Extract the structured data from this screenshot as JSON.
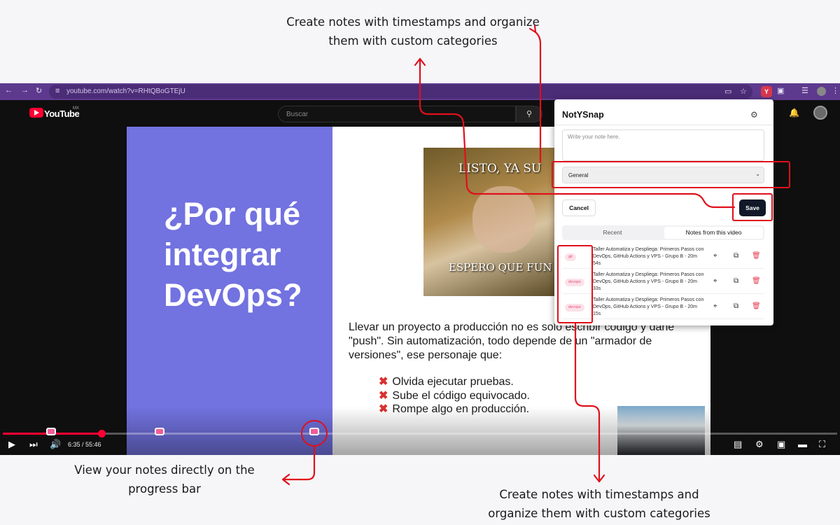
{
  "captions": {
    "top": "Create notes with timestamps and organize them with custom categories",
    "left": "View your notes directly on the progress bar",
    "bottom": "Create notes with timestamps and organize them with custom categories"
  },
  "browser": {
    "url": "youtube.com/watch?v=RHtQBoGTEjU",
    "extension_badge": "Y",
    "icons": [
      "back-icon",
      "forward-icon",
      "reload-icon",
      "site-info-icon",
      "cast-icon",
      "star-icon",
      "extensions-icon",
      "menu-icon"
    ]
  },
  "youtube": {
    "brand": "YouTube",
    "region": "MX",
    "search_placeholder": "Buscar"
  },
  "slide": {
    "title": "¿Por qué integrar DevOps?",
    "meme_top": "LISTO, YA SU",
    "meme_bottom": "ESPERO QUE FUN",
    "body": "Llevar un proyecto a producción no es solo escribir código y darle \"push\". Sin automatización, todo depende de un \"armador de versiones\", ese personaje que:",
    "bullets": [
      "Olvida ejecutar pruebas.",
      "Sube el código equivocado.",
      "Rompe algo en producción."
    ]
  },
  "player": {
    "current_time": "6:35",
    "duration": "55:46",
    "time_display": "6:35 / 55:46",
    "progress_fraction": 0.118,
    "note_markers_fraction": [
      0.058,
      0.188,
      0.373
    ]
  },
  "popup": {
    "title": "NotYSnap",
    "note_placeholder": "Write your note here.",
    "category_selected": "General",
    "cancel_label": "Cancel",
    "save_label": "Save",
    "tabs": [
      {
        "label": "Recent",
        "active": false
      },
      {
        "label": "Notes from this video",
        "active": true
      }
    ],
    "notes": [
      {
        "category": "git",
        "title": "Taller Automatiza y Despliega: Primeros Pasos con DevOps, GitHub Actions y VPS - Grupo B - 20m 54s"
      },
      {
        "category": "devops",
        "title": "Taller Automatiza y Despliega: Primeros Pasos con DevOps, GitHub Actions y VPS - Grupo B - 20m 33s"
      },
      {
        "category": "devops",
        "title": "Taller Automatiza y Despliega: Primeros Pasos con DevOps, GitHub Actions y VPS - Grupo B - 20m 15s"
      }
    ]
  },
  "colors": {
    "accent": "#ff0033",
    "browser_bar": "#5d3a8e",
    "slide_purple": "#7272e0",
    "annotation_red": "#e0101c",
    "note_marker": "#f25e9a",
    "save_button": "#111827"
  }
}
